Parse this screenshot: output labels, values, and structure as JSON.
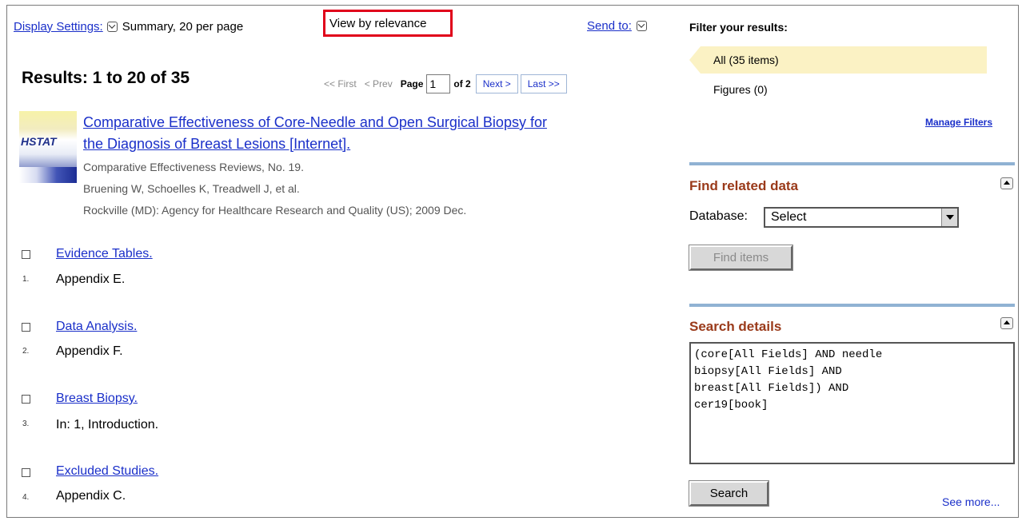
{
  "toolbar": {
    "display_settings": "Display Settings:",
    "summary": "Summary, 20 per page",
    "view_by": "View by relevance",
    "send_to": "Send to:"
  },
  "results": {
    "heading": "Results: 1 to 20 of 35",
    "pager": {
      "first": "<< First",
      "prev": "< Prev",
      "page_label": "Page",
      "page_value": "1",
      "of": "of 2",
      "next": "Next >",
      "last": "Last >>"
    },
    "book": {
      "logo_text": "HSTAT",
      "title_line1": "Comparative Effectiveness of Core-Needle and Open Surgical Biopsy for",
      "title_line2": "the Diagnosis of Breast Lesions [Internet].",
      "series": "Comparative Effectiveness Reviews, No. 19.",
      "authors": "Bruening W, Schoelles K, Treadwell J, et al.",
      "publisher": "Rockville (MD): Agency for Healthcare Research and Quality (US); 2009 Dec."
    },
    "items": [
      {
        "num": "1.",
        "title": "Evidence Tables.",
        "sub": "Appendix E."
      },
      {
        "num": "2.",
        "title": "Data Analysis.",
        "sub": "Appendix F."
      },
      {
        "num": "3.",
        "title": "Breast Biopsy.",
        "sub": "In: 1, Introduction."
      },
      {
        "num": "4.",
        "title": "Excluded Studies.",
        "sub": "Appendix C."
      }
    ]
  },
  "sidebar": {
    "filter_heading": "Filter your results:",
    "filter_all": "All (35 items)",
    "filter_figures": "Figures (0)",
    "manage_filters": "Manage Filters",
    "related_heading": "Find related data",
    "database_label": "Database:",
    "database_value": "Select",
    "find_items": "Find items",
    "search_heading": "Search details",
    "query": "(core[All Fields] AND needle\nbiopsy[All Fields] AND\nbreast[All Fields]) AND\ncer19[book]",
    "search_button": "Search",
    "see_more": "See more..."
  }
}
